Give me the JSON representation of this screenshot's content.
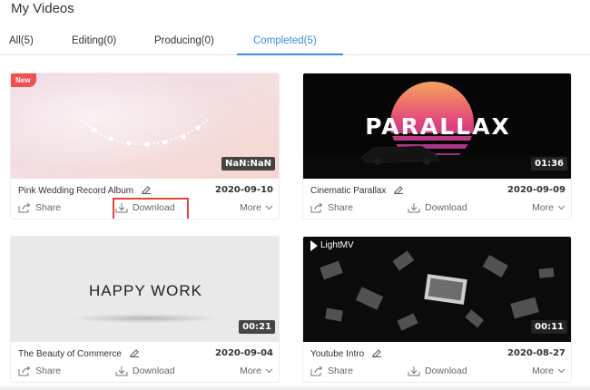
{
  "page": {
    "title": "My Videos"
  },
  "tabs": [
    {
      "label": "All(5)",
      "active": false
    },
    {
      "label": "Editing(0)",
      "active": false
    },
    {
      "label": "Producing(0)",
      "active": false
    },
    {
      "label": "Completed(5)",
      "active": true
    }
  ],
  "actions": {
    "share": "Share",
    "download": "Download",
    "more": "More"
  },
  "colors": {
    "accent": "#3a8ee6",
    "highlight": "#e0463a",
    "new_badge": "#f0504f"
  },
  "cards": [
    {
      "title": "Pink Wedding Record Album",
      "date": "2020-09-10",
      "duration": "NaN:NaN",
      "badge": "New"
    },
    {
      "title": "Cinematic Parallax",
      "date": "2020-09-09",
      "duration": "01:36",
      "thumb_text": "PARALLAX"
    },
    {
      "title": "The Beauty of Commerce",
      "date": "2020-09-04",
      "duration": "00:21",
      "thumb_text": "HAPPY WORK"
    },
    {
      "title": "Youtube Intro",
      "date": "2020-08-27",
      "duration": "00:11",
      "thumb_text": "LightMV"
    }
  ]
}
